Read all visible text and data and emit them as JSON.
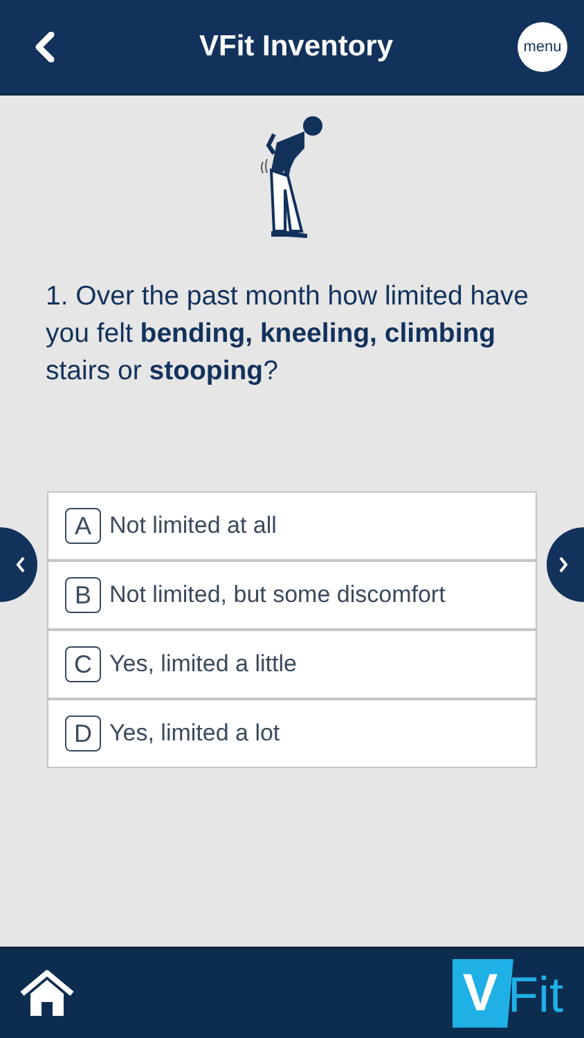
{
  "header": {
    "title": "VFit Inventory",
    "menu_label": "menu"
  },
  "question": "1. Over the past month how limited have you felt **bending, kneeling, climbing** stairs or **stooping**?",
  "options": [
    {
      "letter": "A",
      "text": "Not limited at all"
    },
    {
      "letter": "B",
      "text": "Not limited, but some discomfort"
    },
    {
      "letter": "C",
      "text": "Yes, limited a little"
    },
    {
      "letter": "D",
      "text": "Yes, limited a lot"
    }
  ],
  "logo": {
    "mark": "V",
    "text": "Fit"
  }
}
